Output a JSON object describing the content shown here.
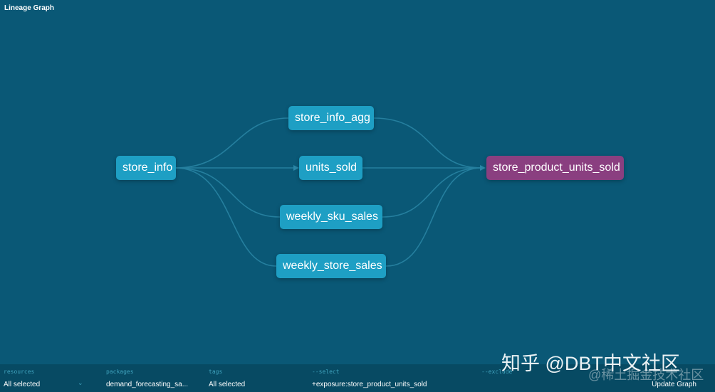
{
  "header": {
    "title": "Lineage Graph"
  },
  "graph": {
    "nodes": [
      {
        "id": "store_info",
        "label": "store_info",
        "type": "source"
      },
      {
        "id": "store_info_agg",
        "label": "store_info_agg",
        "type": "model"
      },
      {
        "id": "units_sold",
        "label": "units_sold",
        "type": "model"
      },
      {
        "id": "weekly_sku_sales",
        "label": "weekly_sku_sales",
        "type": "model"
      },
      {
        "id": "weekly_store_sales",
        "label": "weekly_store_sales",
        "type": "model"
      },
      {
        "id": "store_product_units_sold",
        "label": "store_product_units_sold",
        "type": "exposure"
      }
    ],
    "edges": [
      [
        "store_info",
        "store_info_agg"
      ],
      [
        "store_info",
        "units_sold"
      ],
      [
        "store_info",
        "weekly_sku_sales"
      ],
      [
        "store_info",
        "weekly_store_sales"
      ],
      [
        "store_info_agg",
        "store_product_units_sold"
      ],
      [
        "units_sold",
        "store_product_units_sold"
      ],
      [
        "weekly_sku_sales",
        "store_product_units_sold"
      ],
      [
        "weekly_store_sales",
        "store_product_units_sold"
      ]
    ],
    "colors": {
      "model": "#1e9fc4",
      "exposure": "#8a3f80",
      "edge": "#2a86a6",
      "background": "#0a5876"
    }
  },
  "filters": {
    "resources": {
      "label": "resources",
      "value": "All selected"
    },
    "packages": {
      "label": "packages",
      "value": "demand_forecasting_sa..."
    },
    "tags": {
      "label": "tags",
      "value": "All selected"
    },
    "select": {
      "label": "--select",
      "value": "+exposure:store_product_units_sold"
    },
    "exclude": {
      "label": "--exclude",
      "value": ""
    },
    "update_label": "Update Graph"
  },
  "watermark": {
    "text": "知乎 @DBT中文社区",
    "subtext": "@稀土掘金技术社区"
  }
}
